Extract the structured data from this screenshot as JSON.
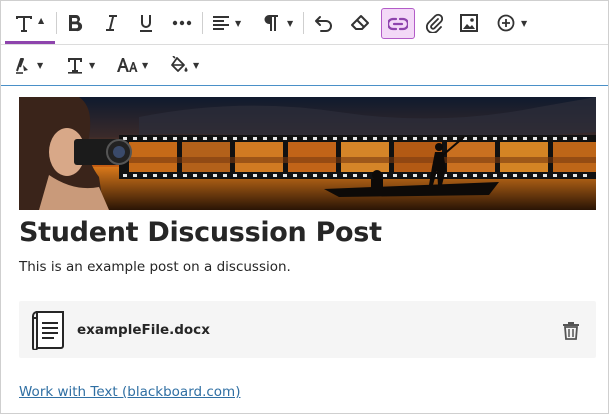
{
  "toolbar": {
    "row1": [
      {
        "name": "text-style-button",
        "icon": "text-style-icon",
        "has_caret": true,
        "active": true
      },
      {
        "name": "bold-button",
        "icon": "bold-icon"
      },
      {
        "name": "italic-button",
        "icon": "italic-icon"
      },
      {
        "name": "underline-button",
        "icon": "underline-icon"
      },
      {
        "name": "more-formatting-button",
        "icon": "more-icon"
      },
      {
        "name": "align-button",
        "icon": "align-left-icon",
        "has_caret": true
      },
      {
        "name": "paragraph-button",
        "icon": "pilcrow-icon",
        "has_caret": true
      },
      {
        "name": "undo-button",
        "icon": "undo-icon"
      },
      {
        "name": "clear-formatting-button",
        "icon": "eraser-icon"
      },
      {
        "name": "insert-link-button",
        "icon": "link-icon",
        "highlighted": true
      },
      {
        "name": "attach-file-button",
        "icon": "paperclip-icon"
      },
      {
        "name": "insert-image-button",
        "icon": "image-icon"
      },
      {
        "name": "insert-content-button",
        "icon": "plus-circle-icon",
        "has_caret": true
      }
    ],
    "row2": [
      {
        "name": "text-color-button",
        "icon": "pen-color-icon",
        "has_caret": true
      },
      {
        "name": "text-format-button",
        "icon": "text-format-icon",
        "has_caret": true
      },
      {
        "name": "font-size-button",
        "icon": "font-size-icon",
        "has_caret": true
      },
      {
        "name": "highlight-button",
        "icon": "fill-bucket-icon",
        "has_caret": true
      }
    ],
    "colors": {
      "active_underline": "#8e44ad",
      "link_highlight_bg": "#f3d9f7",
      "link_highlight_border": "#b35cc8",
      "editor_focus_border": "#4a90c8"
    }
  },
  "content": {
    "banner": {
      "description_icon": "photographer-film-banner-image"
    },
    "title": "Student Discussion Post",
    "body": "This is an example post on a discussion.",
    "attachment": {
      "icon": "document-icon",
      "file_name": "exampleFile.docx",
      "delete_icon": "trash-icon"
    },
    "link_text": "Work with Text (blackboard.com)",
    "link_color": "#2f6fa3"
  }
}
